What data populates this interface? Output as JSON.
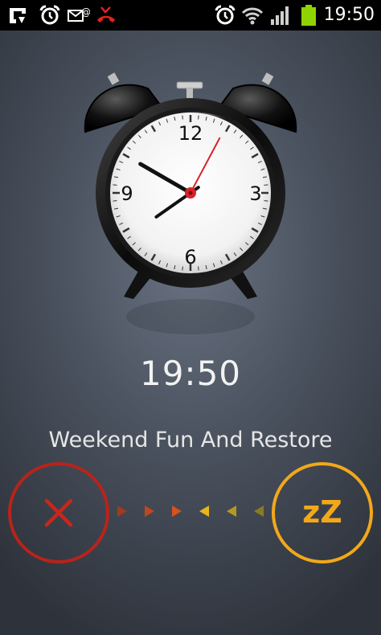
{
  "status_bar": {
    "time": "19:50",
    "left_icons": [
      "notification-app-icon",
      "alarm-clock-icon",
      "mail-icon",
      "missed-call-icon"
    ],
    "right_icons": [
      "alarm-clock-icon",
      "wifi-icon",
      "signal-icon",
      "battery-icon"
    ]
  },
  "clock": {
    "numerals": {
      "top": "12",
      "right": "3",
      "bottom": "6",
      "left": "9"
    },
    "hours": 19,
    "minutes": 50
  },
  "alarm": {
    "time": "19:50",
    "label": "Weekend Fun And Restore"
  },
  "actions": {
    "dismiss_icon": "close-x-icon",
    "snooze_label": "zZ"
  },
  "colors": {
    "dismiss": "#b8231b",
    "snooze": "#f2a81a",
    "second_hand": "#d8232a"
  }
}
